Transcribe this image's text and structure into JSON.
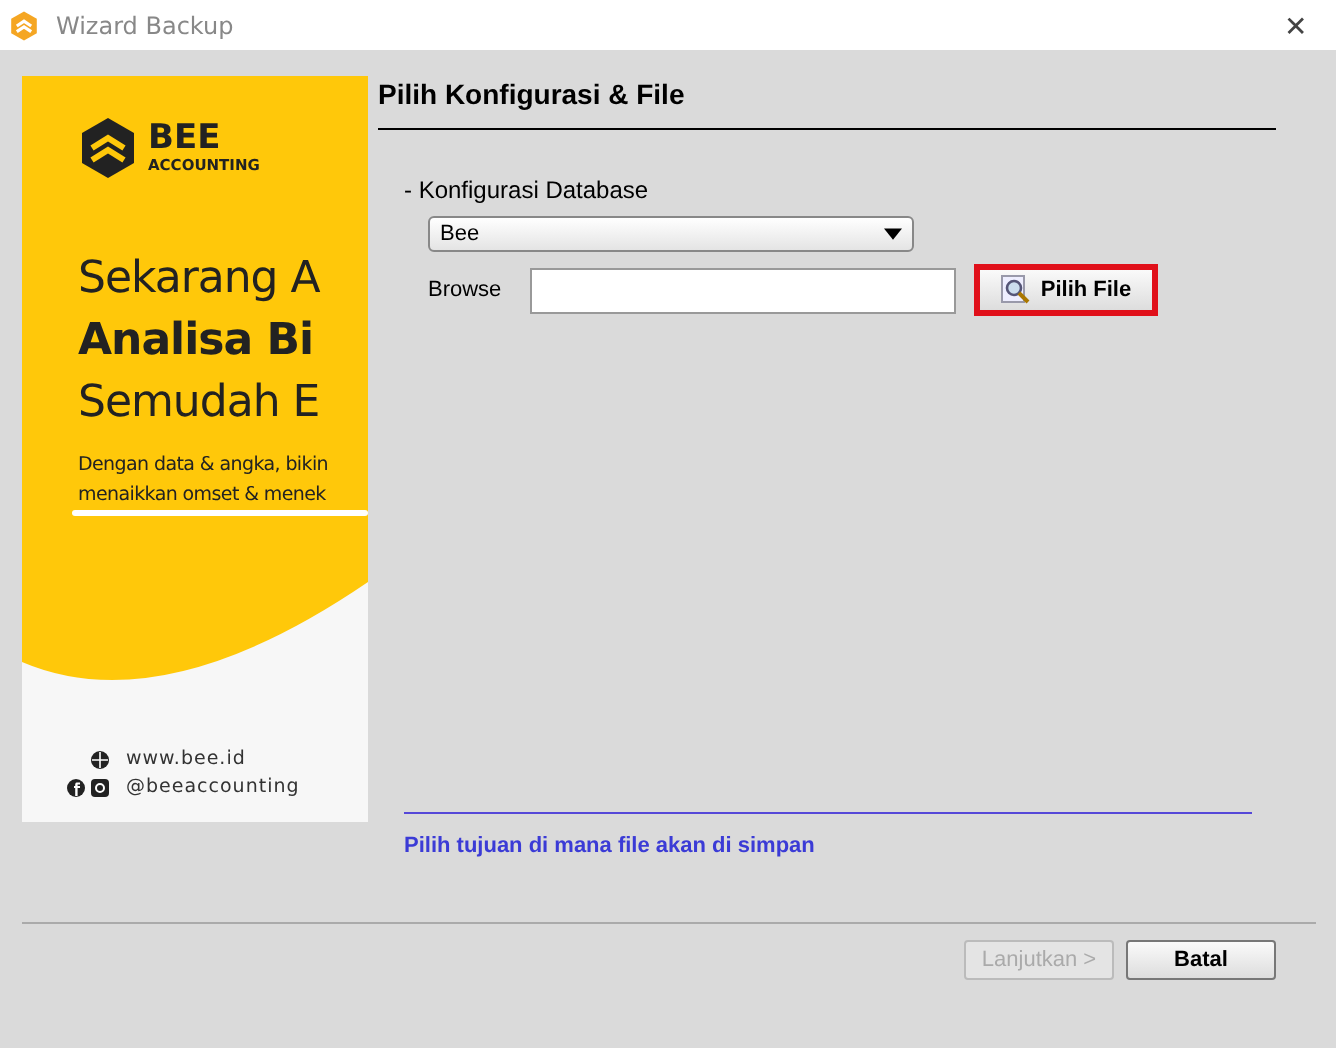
{
  "window": {
    "title": "Wizard Backup",
    "close": "✕"
  },
  "banner": {
    "brand": "BEE",
    "sub": "ACCOUNTING",
    "headline": [
      "Sekarang A",
      "Analisa Bi",
      "Semudah E"
    ],
    "body": [
      "Dengan data & angka, bikin",
      "menaikkan omset & menek"
    ],
    "website": "www.bee.id",
    "social": "@beeaccounting"
  },
  "step_title": "Pilih Konfigurasi & File",
  "section_label": "- Konfigurasi Database",
  "database_select": {
    "value": "Bee"
  },
  "browse": {
    "label": "Browse",
    "button": "Pilih File",
    "highlighted": true
  },
  "hint": "Pilih tujuan di mana file akan di simpan",
  "buttons": [
    {
      "label": "Lanjutkan >",
      "disabled": true
    },
    {
      "label": "Batal",
      "disabled": false
    }
  ]
}
